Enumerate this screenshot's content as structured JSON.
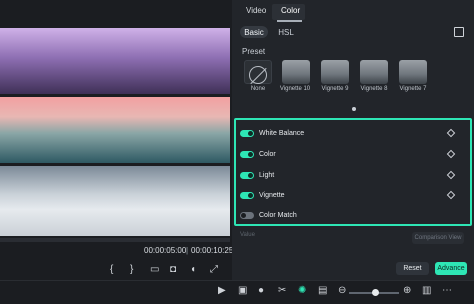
{
  "tabs": {
    "video": "Video",
    "color": "Color"
  },
  "subtabs": {
    "basic": "Basic",
    "hsl": "HSL"
  },
  "preset": {
    "title": "Preset",
    "items": [
      {
        "label": "None"
      },
      {
        "label": "Vignette 10"
      },
      {
        "label": "Vignette 9"
      },
      {
        "label": "Vignette 8"
      },
      {
        "label": "Vignette 7"
      }
    ]
  },
  "adjustments": [
    {
      "label": "White Balance",
      "enabled": true
    },
    {
      "label": "Color",
      "enabled": true
    },
    {
      "label": "Light",
      "enabled": true
    },
    {
      "label": "Vignette",
      "enabled": true
    },
    {
      "label": "Color Match",
      "enabled": false
    }
  ],
  "value_area": {
    "label": "Value",
    "comparison_view": "Comparison View"
  },
  "buttons": {
    "reset": "Reset",
    "advance": "Advance"
  },
  "timecode": {
    "current": "00:00:05:00",
    "total": "00:00:10:25",
    "separator": "|"
  },
  "controls": {
    "bracket_left": "{",
    "bracket_right": "}"
  },
  "colors": {
    "accent": "#2ee6b5",
    "panel": "#22252a",
    "background": "#1b1d21"
  }
}
